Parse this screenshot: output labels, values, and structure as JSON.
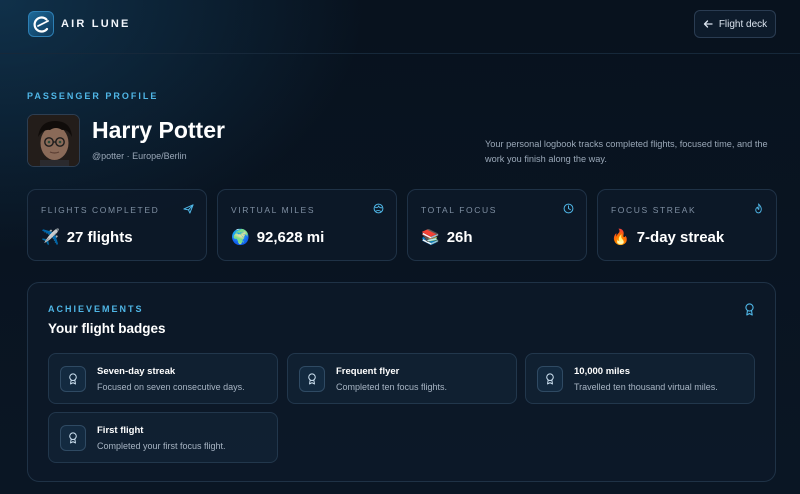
{
  "header": {
    "brand": "AIR LUNE",
    "deck_button": "Flight deck"
  },
  "profile": {
    "eyebrow": "PASSENGER PROFILE",
    "name": "Harry Potter",
    "handle": "@potter · Europe/Berlin",
    "tagline": "Your personal logbook tracks completed flights, focused time, and the work you finish along the way."
  },
  "stats": [
    {
      "label": "FLIGHTS COMPLETED",
      "emoji": "✈️",
      "value": "27 flights",
      "icon": "airplane-icon"
    },
    {
      "label": "VIRTUAL MILES",
      "emoji": "🌍",
      "value": "92,628 mi",
      "icon": "globe-icon"
    },
    {
      "label": "TOTAL FOCUS",
      "emoji": "📚",
      "value": "26h",
      "icon": "clock-icon"
    },
    {
      "label": "FOCUS STREAK",
      "emoji": "🔥",
      "value": "7-day streak",
      "icon": "flame-icon"
    }
  ],
  "achievements": {
    "eyebrow": "ACHIEVEMENTS",
    "title": "Your flight badges",
    "badges": [
      {
        "title": "Seven-day streak",
        "desc": "Focused on seven consecutive days."
      },
      {
        "title": "Frequent flyer",
        "desc": "Completed ten focus flights."
      },
      {
        "title": "10,000 miles",
        "desc": "Travelled ten thousand virtual miles."
      },
      {
        "title": "First flight",
        "desc": "Completed your first focus flight."
      }
    ]
  },
  "colors": {
    "accent": "#4fb6e6",
    "background": "#08121e",
    "card": "#0d1a2a"
  }
}
